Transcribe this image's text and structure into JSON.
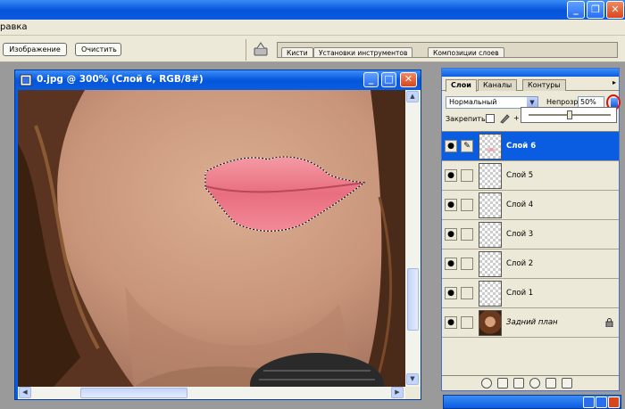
{
  "menu": {
    "partial_item": "равка"
  },
  "options": {
    "image_button": "Изображение",
    "clear_button": "Очистить"
  },
  "palette_well": {
    "tabs": [
      "Кисти",
      "Установки инструментов",
      "Композиции слоев"
    ]
  },
  "document": {
    "title": "0.jpg @ 300% (Слой 6, RGB/8#)"
  },
  "layers_palette": {
    "tabs": [
      "Слои",
      "Каналы",
      "Контуры"
    ],
    "blend_mode": "Нормальный",
    "opacity_label": "Непрозр.:",
    "opacity_value": "50%",
    "opacity_fraction": 0.5,
    "lock_label": "Закрепить:",
    "layers": [
      {
        "name": "Слой 6",
        "selected": true,
        "brush": true
      },
      {
        "name": "Слой 5"
      },
      {
        "name": "Слой 4"
      },
      {
        "name": "Слой 3"
      },
      {
        "name": "Слой 2"
      },
      {
        "name": "Слой 1"
      },
      {
        "name": "Задний план",
        "locked": true,
        "background": true
      }
    ]
  },
  "colors": {
    "xp_blue": "#0a5ce0",
    "selection": "#0a5ce0",
    "highlight_ring": "#e01010",
    "lips": "#f07a8a"
  }
}
